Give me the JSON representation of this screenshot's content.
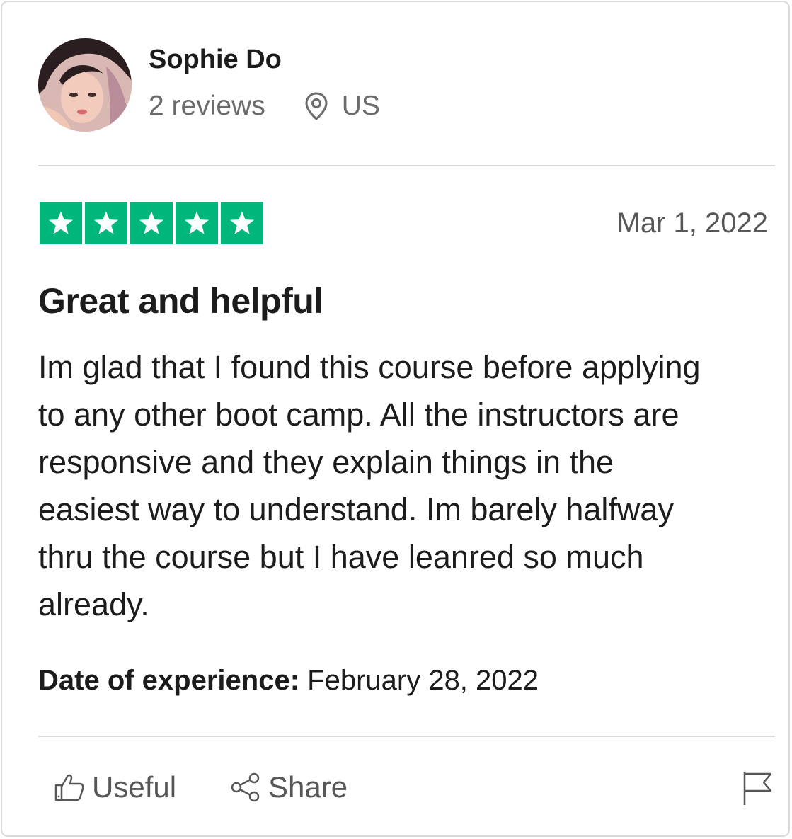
{
  "reviewer": {
    "name": "Sophie Do",
    "reviews_count": "2 reviews",
    "country": "US"
  },
  "review": {
    "rating": 5,
    "rating_max": 5,
    "star_color": "#00b67a",
    "date": "Mar 1, 2022",
    "title": "Great and helpful",
    "body_lines": [
      "Im glad that I found this course before applying",
      "to any other boot camp. All the instructors are",
      "responsive and they explain things in the",
      "easiest way to understand. Im barely halfway",
      "thru the course but I have leanred so much",
      "already."
    ],
    "experience_label": "Date of experience:",
    "experience_date": " February 28, 2022"
  },
  "actions": {
    "useful_label": "Useful",
    "share_label": "Share"
  },
  "icons": {
    "location": "map-pin-icon",
    "useful": "thumbs-up-icon",
    "share": "share-icon",
    "report": "flag-icon",
    "star": "star-icon"
  }
}
